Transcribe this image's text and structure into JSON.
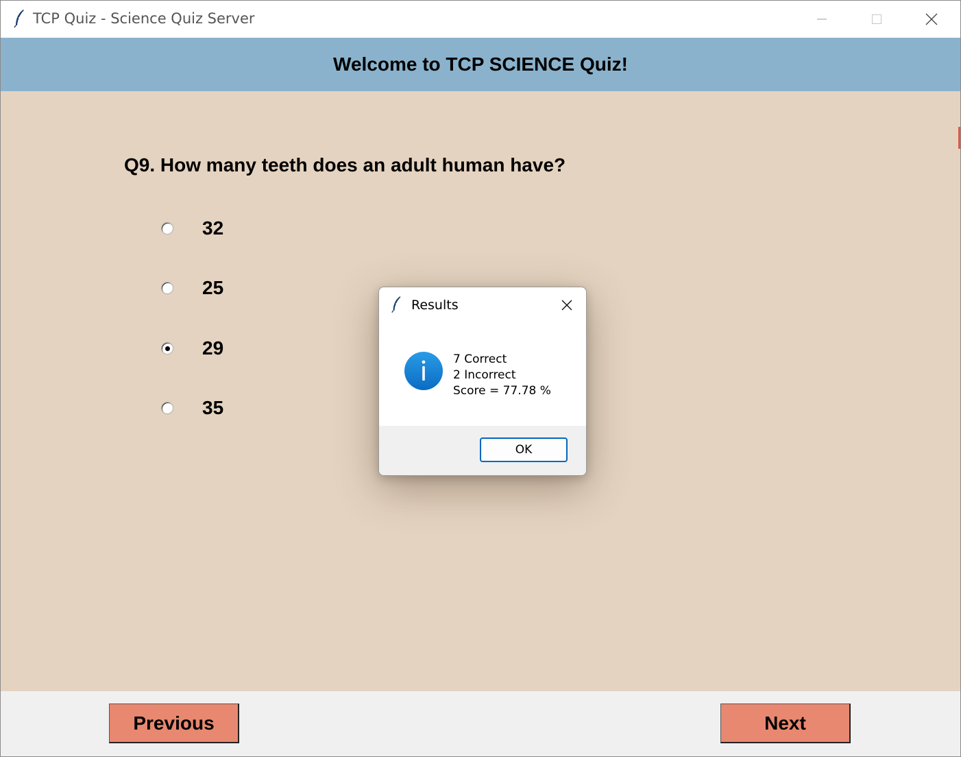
{
  "window": {
    "title": "TCP Quiz - Science Quiz Server",
    "icon": "feather-icon"
  },
  "header": {
    "title": "Welcome to TCP SCIENCE Quiz!",
    "background": "#8ab2cc"
  },
  "quiz": {
    "question": "Q9. How many teeth does an adult human have?",
    "options": [
      {
        "label": "32",
        "selected": false
      },
      {
        "label": "25",
        "selected": false
      },
      {
        "label": "29",
        "selected": true
      },
      {
        "label": "35",
        "selected": false
      }
    ],
    "background": "#e4d3c0"
  },
  "navigation": {
    "previous_label": "Previous",
    "next_label": "Next",
    "button_color": "#e88870"
  },
  "dialog": {
    "title": "Results",
    "icon": "info-icon",
    "lines": [
      "7 Correct",
      "2 Incorrect",
      "Score = 77.78 %"
    ],
    "ok_label": "OK",
    "accent": "#0067c0"
  }
}
